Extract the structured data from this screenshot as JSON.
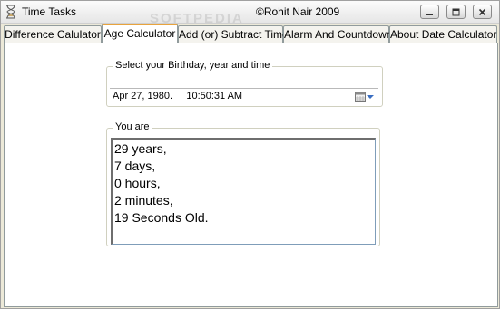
{
  "window": {
    "title": "Time Tasks",
    "center_title": "©Rohit Nair 2009"
  },
  "tabs": [
    {
      "label": "Difference Calulator",
      "active": false
    },
    {
      "label": "Age Calculator",
      "active": true
    },
    {
      "label": "Add (or) Subtract Time",
      "active": false
    },
    {
      "label": "Alarm And Countdown",
      "active": false
    },
    {
      "label": "About Date Calculator",
      "active": false
    }
  ],
  "birthday_group": {
    "legend": "Select your Birthday, year and time",
    "value": "Apr 27, 1980.     10:50:31 AM"
  },
  "result_group": {
    "legend": "You are",
    "lines": [
      "29 years,",
      "7 days,",
      "0 hours,",
      "2 minutes,",
      "19 Seconds Old."
    ]
  },
  "watermark": "SOFTPEDIA",
  "colors": {
    "active_tab_accent": "#e8a33d",
    "panel_background": "#ffffff",
    "window_background": "#ece9d8"
  },
  "icons": {
    "app": "hourglass-icon",
    "minimize": "minimize-icon",
    "maximize": "maximize-icon",
    "close": "close-icon",
    "calendar": "calendar-icon",
    "dropdown": "chevron-down-icon"
  }
}
